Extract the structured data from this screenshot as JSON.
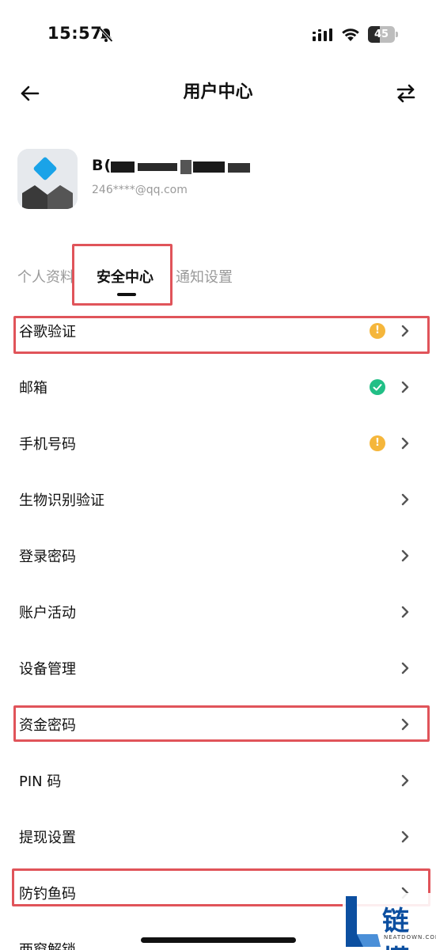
{
  "status_bar": {
    "time": "15:57",
    "battery": "45",
    "battery_level_percent": 45
  },
  "header": {
    "title": "用户中心",
    "back_icon": "arrow-left-icon",
    "switch_icon": "switch-arrows-icon"
  },
  "profile": {
    "name_visible": "B(",
    "email": "246****@qq.com"
  },
  "tabs": [
    {
      "label": "个人资料",
      "active": false
    },
    {
      "label": "安全中心",
      "active": true
    },
    {
      "label": "通知设置",
      "active": false
    }
  ],
  "menu": [
    {
      "label": "谷歌验证",
      "status": "warning",
      "status_symbol": "!"
    },
    {
      "label": "邮箱",
      "status": "verified"
    },
    {
      "label": "手机号码",
      "status": "warning",
      "status_symbol": "!"
    },
    {
      "label": "生物识别验证"
    },
    {
      "label": "登录密码"
    },
    {
      "label": "账户活动"
    },
    {
      "label": "设备管理"
    },
    {
      "label": "资金密码"
    },
    {
      "label": "PIN 码"
    },
    {
      "label": "提现设置"
    },
    {
      "label": "防钓鱼码"
    },
    {
      "label": "两窗解锁"
    }
  ],
  "colors": {
    "warning": "#f5b63b",
    "verified": "#21bf86",
    "highlight": "#e0545a",
    "avatar_accent": "#1aa3e8"
  },
  "watermark": {
    "text": "链懂",
    "sub": "NEATDOWN.COM"
  }
}
